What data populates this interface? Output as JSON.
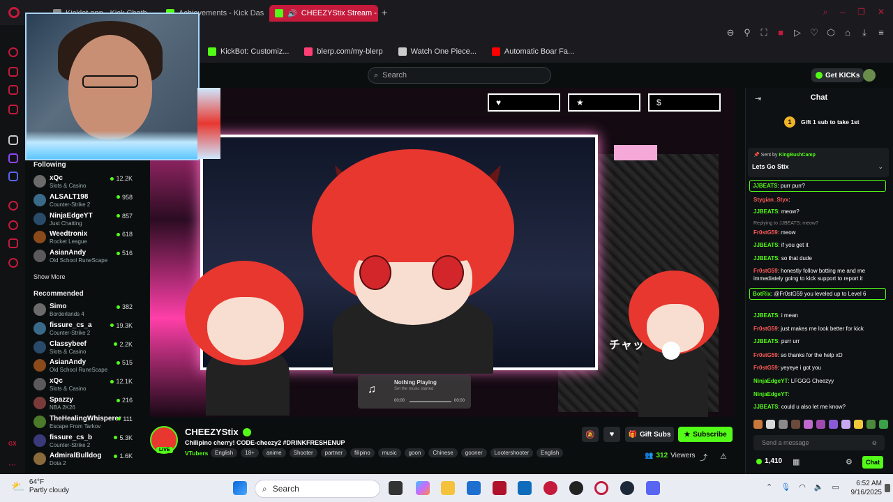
{
  "browser": {
    "tabs": [
      {
        "label": "Kicklet.app - Kick Chatb"
      },
      {
        "label": "Achievements - Kick Das"
      },
      {
        "label": "CHEEZYStix Stream -"
      }
    ],
    "bookmarks": [
      {
        "label": "KickBot: Customiz...",
        "color": "#53fc18"
      },
      {
        "label": "blerp.com/my-blerp",
        "color": "#ff3f74"
      },
      {
        "label": "Watch One Piece...",
        "color": "#cccccc"
      },
      {
        "label": "Automatic Boar Fa...",
        "color": "#ff0000"
      }
    ]
  },
  "header": {
    "search_placeholder": "Search",
    "get_kicks": "Get KICKs"
  },
  "sidebar": {
    "following_title": "Following",
    "following": [
      {
        "name": "xQc",
        "category": "Slots & Casino",
        "viewers": "12.2K"
      },
      {
        "name": "ALSALT198",
        "category": "Counter-Strike 2",
        "viewers": "958"
      },
      {
        "name": "NinjaEdgeYT",
        "category": "Just Chatting",
        "viewers": "857"
      },
      {
        "name": "Weedtronix",
        "category": "Rocket League",
        "viewers": "618"
      },
      {
        "name": "AsianAndy",
        "category": "Old School RuneScape",
        "viewers": "516"
      }
    ],
    "show_more": "Show More",
    "recommended_title": "Recommended",
    "recommended": [
      {
        "name": "Simo",
        "category": "Borderlands 4",
        "viewers": "382"
      },
      {
        "name": "fissure_cs_a",
        "category": "Counter-Strike 2",
        "viewers": "19.3K"
      },
      {
        "name": "Classybeef",
        "category": "Slots & Casino",
        "viewers": "2.2K"
      },
      {
        "name": "AsianAndy",
        "category": "Old School RuneScape",
        "viewers": "515"
      },
      {
        "name": "xQc",
        "category": "Slots & Casino",
        "viewers": "12.1K"
      },
      {
        "name": "Spazzy",
        "category": "NBA 2K26",
        "viewers": "216"
      },
      {
        "name": "TheHealingWhisperer",
        "category": "Escape From Tarkov",
        "viewers": "111"
      },
      {
        "name": "fissure_cs_b",
        "category": "Counter-Strike 2",
        "viewers": "5.3K"
      },
      {
        "name": "AdmiralBulldog",
        "category": "Dota 2",
        "viewers": "1.6K"
      }
    ]
  },
  "video": {
    "top_boxes": [
      "♥",
      "★",
      "$"
    ],
    "now_playing_title": "Nothing Playing",
    "now_playing_sub": "Set the music started",
    "time_start": "00:00",
    "time_end": "00:00",
    "overlay_text": "チャッ"
  },
  "stream": {
    "channel": "CHEEZYStix",
    "live": "LIVE",
    "title": "Chilipino cherry! CODE-cheezy2 #DRINKFRESHENUP",
    "category": "VTubers",
    "tags": [
      "English",
      "18+",
      "anime",
      "Shooter",
      "partner",
      "filipino",
      "music",
      "goon",
      "Chinese",
      "gooner",
      "Lootershooter",
      "English"
    ],
    "gift_subs": "Gift Subs",
    "subscribe": "Subscribe",
    "viewers": "312",
    "viewers_label": "Viewers"
  },
  "chat": {
    "title": "Chat",
    "gift_prompt": "Gift 1 sub to take 1st",
    "gift_rank": "1",
    "pinned_sent_by": "Sent by",
    "pinned_user": "KingBushCamp",
    "pinned_message": "Lets Go Stix",
    "messages": [
      {
        "user": "JJBEATS",
        "text": ": purr purr?",
        "color": "#53fc18",
        "highlight": true
      },
      {
        "user": "Stygian_Styx",
        "text": ":",
        "color": "#ff5a5a"
      },
      {
        "user": "JJBEATS",
        "text": ": meow?",
        "color": "#53fc18"
      },
      {
        "user": "Fr0stG59",
        "text": ": meow",
        "color": "#ff5a5a",
        "reply": "Replying to JJBEATS: meow?"
      },
      {
        "user": "JJBEATS",
        "text": ": if you get it",
        "color": "#53fc18"
      },
      {
        "user": "JJBEATS",
        "text": ": so that dude",
        "color": "#53fc18"
      },
      {
        "user": "Fr0stG59",
        "text": ": honestly follow botting me and me immediately going to kick support to report it",
        "color": "#ff5a5a"
      },
      {
        "user": "BotRix",
        "text": ": @Fr0stG59 you leveled up to Level 6",
        "color": "#53fc18",
        "highlight": true
      },
      {
        "user": "JJBEATS",
        "text": ": i mean",
        "color": "#53fc18"
      },
      {
        "user": "Fr0stG59",
        "text": ": just makes me look better for kick",
        "color": "#ff5a5a"
      },
      {
        "user": "JJBEATS",
        "text": ": purr urr",
        "color": "#53fc18"
      },
      {
        "user": "Fr0stG59",
        "text": ": so thanks for the help xD",
        "color": "#ff5a5a"
      },
      {
        "user": "Fr0stG59",
        "text": ": yeyeye i got you",
        "color": "#ff5a5a"
      },
      {
        "user": "NinjaEdgeYT",
        "text": ": LFGGG Cheezyy",
        "color": "#53fc18"
      },
      {
        "user": "NinjaEdgeYT",
        "text": ":",
        "color": "#53fc18"
      },
      {
        "user": "JJBEATS",
        "text": ": could u also let me know?",
        "color": "#53fc18"
      }
    ],
    "send_placeholder": "Send a message",
    "points": "1,410",
    "chat_button": "Chat"
  },
  "taskbar": {
    "temp": "64°F",
    "condition": "Partly cloudy",
    "search": "Search",
    "time": "6:52 AM",
    "date": "9/16/2025"
  }
}
